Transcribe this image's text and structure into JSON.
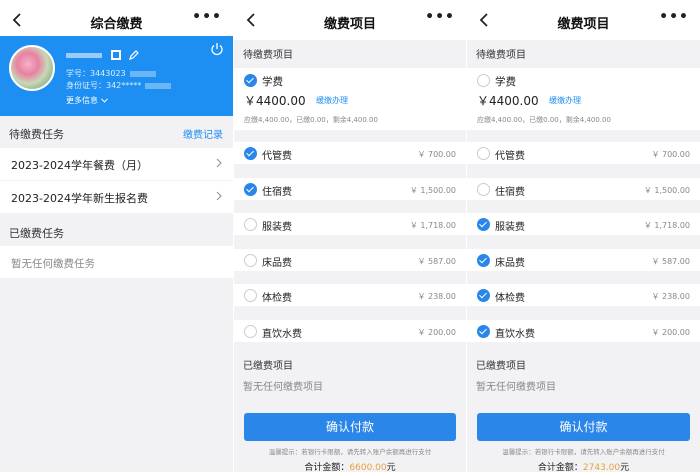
{
  "panel1": {
    "title": "综合缴费",
    "more": "•••",
    "profile": {
      "student_no_label": "学号：",
      "student_no": "3443023",
      "id_label": "身份证号：",
      "id_no": "342*****",
      "more_info": "更多信息",
      "chevron": "chevron-down-icon"
    },
    "pending_title": "待缴费任务",
    "record_link": "缴费记录",
    "tasks": [
      {
        "label": "2023-2024学年餐费（月）"
      },
      {
        "label": "2023-2024学年新生报名费"
      }
    ],
    "paid_title": "已缴费任务",
    "paid_empty": "暂无任何缴费任务"
  },
  "panel2": {
    "title": "缴费项目",
    "more": "•••",
    "pending_title": "待缴费项目",
    "main_fee": {
      "name": "学费",
      "checked": true,
      "amount": "￥4400.00",
      "deferred": "缓缴办理",
      "detail": "应缴4,400.00，已缴0.00，剩余4,400.00"
    },
    "items": [
      {
        "name": "代管费",
        "price": "￥ 700.00",
        "checked": true
      },
      {
        "name": "住宿费",
        "price": "￥ 1,500.00",
        "checked": true
      },
      {
        "name": "服装费",
        "price": "￥ 1,718.00",
        "checked": false
      },
      {
        "name": "床品费",
        "price": "￥ 587.00",
        "checked": false
      },
      {
        "name": "体检费",
        "price": "￥ 238.00",
        "checked": false
      },
      {
        "name": "直饮水费",
        "price": "￥ 200.00",
        "checked": false
      }
    ],
    "paid_title": "已缴费项目",
    "paid_empty": "暂无任何缴费项目",
    "confirm": "确认付款",
    "hint": "温馨提示：若银行卡限额，请先转入账户余额再进行支付",
    "total_label": "合计金额：",
    "total_amount": "6600.00",
    "total_unit": "元"
  },
  "panel3": {
    "title": "缴费项目",
    "more": "•••",
    "pending_title": "待缴费项目",
    "main_fee": {
      "name": "学费",
      "checked": false,
      "amount": "￥4400.00",
      "deferred": "缓缴办理",
      "detail": "应缴4,400.00，已缴0.00，剩余4,400.00"
    },
    "items": [
      {
        "name": "代管费",
        "price": "￥ 700.00",
        "checked": false
      },
      {
        "name": "住宿费",
        "price": "￥ 1,500.00",
        "checked": false
      },
      {
        "name": "服装费",
        "price": "￥ 1,718.00",
        "checked": true
      },
      {
        "name": "床品费",
        "price": "￥ 587.00",
        "checked": true
      },
      {
        "name": "体检费",
        "price": "￥ 238.00",
        "checked": true
      },
      {
        "name": "直饮水费",
        "price": "￥ 200.00",
        "checked": true
      }
    ],
    "paid_title": "已缴费项目",
    "paid_empty": "暂无任何缴费项目",
    "confirm": "确认付款",
    "hint": "温馨提示：若银行卡限额，请先转入账户余额再进行支付",
    "total_label": "合计金额：",
    "total_amount": "2743.00",
    "total_unit": "元"
  },
  "colors": {
    "accent": "#2a86e9",
    "profile_bg": "#1e8ff2",
    "total_amount": "#e8a13a"
  }
}
